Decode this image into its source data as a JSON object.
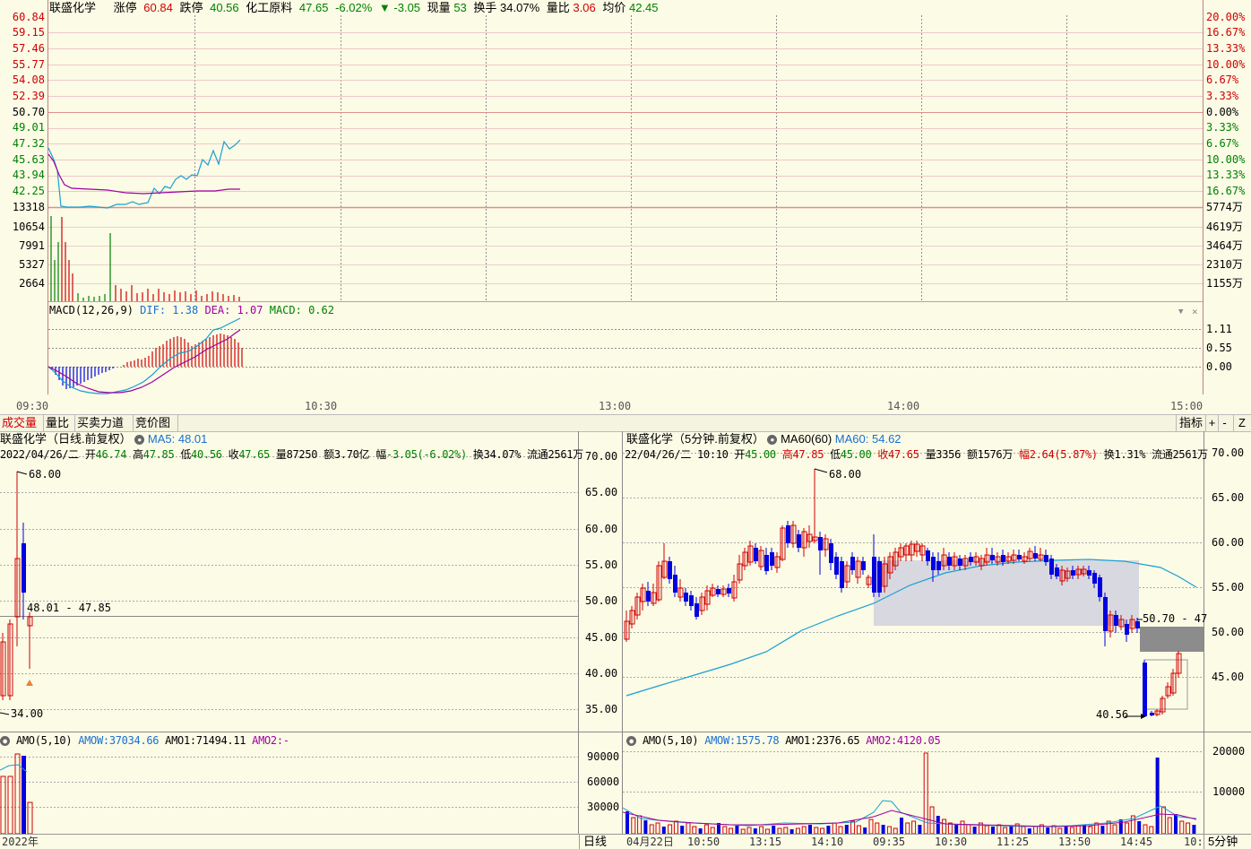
{
  "top": {
    "stock_name": "联盛化学",
    "limit_up_label": "涨停",
    "limit_up_value": "60.84",
    "limit_down_label": "跌停",
    "limit_down_value": "40.56",
    "sector_name": "化工原料",
    "sector_price": "47.65",
    "sector_pct": "-6.02%",
    "change_arrow": "▼",
    "change_value": "-3.05",
    "volume_label": "现量",
    "volume_value": "53",
    "turnover_label": "换手",
    "turnover_value": "34.07%",
    "ratio_label": "量比",
    "ratio_value": "3.06",
    "avg_label": "均价",
    "avg_value": "42.45",
    "price_axis": [
      "60.84",
      "59.15",
      "57.46",
      "55.77",
      "54.08",
      "52.39",
      "50.70",
      "49.01",
      "47.32",
      "45.63",
      "43.94",
      "42.25"
    ],
    "pct_axis": [
      "20.00%",
      "16.67%",
      "13.33%",
      "10.00%",
      "6.67%",
      "3.33%",
      "0.00%",
      "3.33%",
      "6.67%",
      "10.00%",
      "13.33%",
      "16.67%"
    ],
    "vol_axis_left": [
      "13318",
      "10654",
      "7991",
      "5327",
      "2664"
    ],
    "vol_axis_right": [
      "5774万",
      "4619万",
      "3464万",
      "2310万",
      "1155万"
    ],
    "macd_label": "MACD(12,26,9)",
    "dif_label": "DIF:",
    "dif_value": "1.38",
    "dea_label": "DEA:",
    "dea_value": "1.07",
    "macd_value_label": "MACD:",
    "macd_value": "0.62",
    "macd_axis": [
      "1.11",
      "0.55",
      "0.00"
    ],
    "time_axis": [
      "09:30",
      "10:30",
      "13:00",
      "14:00",
      "15:00"
    ]
  },
  "tabs": [
    "成交量",
    "量比",
    "买卖力道",
    "竞价图"
  ],
  "toolbar": {
    "indicator": "指标",
    "plus": "+",
    "minus": "-",
    "z": "Z"
  },
  "left_chart": {
    "title": "联盛化学（日线.前复权）",
    "ma5_label": "MA5:",
    "ma5_value": "48.01",
    "date": "2022/04/26/二",
    "open_label": "开",
    "open": "46.74",
    "high_label": "高",
    "high": "47.85",
    "low_label": "低",
    "low": "40.56",
    "close_label": "收",
    "close": "47.65",
    "vol_label": "量",
    "vol": "87250",
    "amt_label": "额",
    "amt": "3.70亿",
    "amp_label": "幅",
    "amp": "-3.05(-6.02%)",
    "turn_label": "换",
    "turn": "34.07%",
    "float_label": "流通",
    "float": "2561万",
    "max_label": "68.00",
    "min_label": "34.00",
    "ma_marker": "48.01 - 47.85",
    "y_axis": [
      "70.00",
      "65.00",
      "60.00",
      "55.00",
      "50.00",
      "45.00",
      "40.00",
      "35.00"
    ],
    "amo_label": "AMO(5,10)",
    "amow_label": "AMOW:",
    "amow": "37034.66",
    "amo1_label": "AMO1:",
    "amo1": "71494.11",
    "amo2_label": "AMO2:",
    "amo2": "-",
    "amo_axis": [
      "90000",
      "60000",
      "30000"
    ],
    "x_label": "2022年",
    "period_button": "日线"
  },
  "right_chart": {
    "title": "联盛化学（5分钟.前复权）",
    "ma60_label": "MA60(60)",
    "ma60_name": "MA60:",
    "ma60_value": "54.62",
    "date": "22/04/26/二",
    "time": "10:10",
    "open_label": "开",
    "open": "45.00",
    "high_label": "高",
    "high": "47.85",
    "low_label": "低",
    "low": "45.00",
    "close_label": "收",
    "close": "47.65",
    "vol_label": "量",
    "vol": "3356",
    "amt_label": "额",
    "amt": "1576万",
    "amp_label": "幅",
    "amp": "2.64(5.87%)",
    "turn_label": "换",
    "turn": "1.31%",
    "float_label": "流通",
    "float": "2561万",
    "max_label": "68.00",
    "min_label": "40.56",
    "range_label": "50.70 - 47",
    "y_axis": [
      "70.00",
      "65.00",
      "60.00",
      "55.00",
      "50.00",
      "45.00"
    ],
    "amo_label": "AMO(5,10)",
    "amow_label": "AMOW:",
    "amow": "1575.78",
    "amo1_label": "AMO1:",
    "amo1": "2376.65",
    "amo2_label": "AMO2:",
    "amo2": "4120.05",
    "amo_axis": [
      "20000",
      "10000"
    ],
    "x_axis": [
      "04月22日",
      "10:50",
      "13:15",
      "14:10",
      "09:35",
      "10:30",
      "11:25",
      "13:50",
      "14:45",
      "10:"
    ],
    "period_button": "5分钟"
  },
  "colors": {
    "up": "#d00000",
    "down": "#0000e0",
    "price_line": "#1a9fd0",
    "avg_line": "#a000a0",
    "grid_red": "#e8a0a0"
  }
}
